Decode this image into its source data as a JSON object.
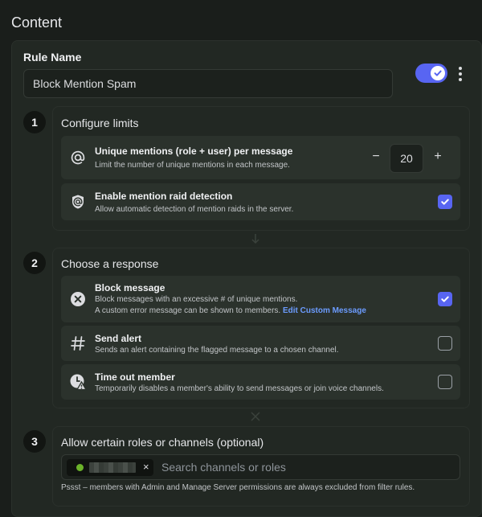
{
  "page": {
    "title": "Content"
  },
  "rule": {
    "name_label": "Rule Name",
    "name_value": "Block Mention Spam",
    "enabled": true
  },
  "sections": {
    "s1": {
      "number": "1",
      "title": "Configure limits"
    },
    "s2": {
      "number": "2",
      "title": "Choose a response"
    },
    "s3": {
      "number": "3",
      "title": "Allow certain roles or channels (optional)"
    }
  },
  "limits": {
    "unique_mentions": {
      "icon": "at-sign-icon",
      "title": "Unique mentions (role + user) per message",
      "desc": "Limit the number of unique mentions in each message.",
      "value": "20",
      "minus": "−",
      "plus": "+"
    },
    "raid_detection": {
      "icon": "at-shield-icon",
      "title": "Enable mention raid detection",
      "desc": "Allow automatic detection of mention raids in the server.",
      "checked": true
    }
  },
  "responses": {
    "block": {
      "icon": "circle-x-icon",
      "title": "Block message",
      "desc_line1": "Block messages with an excessive # of unique mentions.",
      "desc_line2": "A custom error message can be shown to members.",
      "link": "Edit Custom Message",
      "checked": true
    },
    "alert": {
      "icon": "hash-icon",
      "title": "Send alert",
      "desc": "Sends an alert containing the flagged message to a chosen channel.",
      "checked": false
    },
    "timeout": {
      "icon": "clock-warning-icon",
      "title": "Time out member",
      "desc": "Temporarily disables a member's ability to send messages or join voice channels.",
      "checked": false
    }
  },
  "exemptions": {
    "chip_remove": "×",
    "search_placeholder": "Search channels or roles",
    "footnote": "Pssst – members with Admin and Manage Server permissions are always excluded from filter rules."
  },
  "colors": {
    "accent": "#5865f2",
    "link": "#6c9cff",
    "chip_dot": "#6bb32a"
  }
}
